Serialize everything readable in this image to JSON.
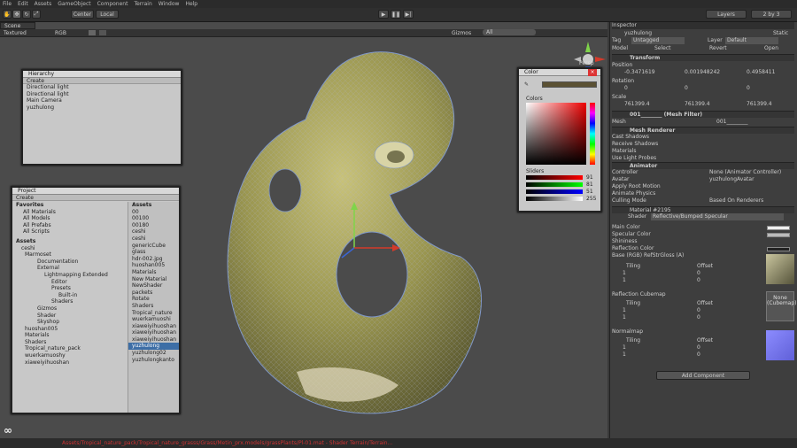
{
  "menu": [
    "File",
    "Edit",
    "Assets",
    "GameObject",
    "Component",
    "Terrain",
    "Window",
    "Help"
  ],
  "toolbar": {
    "pivot": "Center",
    "space": "Local",
    "layers": "Layers",
    "layout": "2 by 3"
  },
  "scene": {
    "tab": "Scene",
    "shading": "Textured",
    "mode": "RGB",
    "gizmos": "Gizmos",
    "search": "All",
    "persp": "Persp"
  },
  "hierarchy": {
    "title": "Hierarchy",
    "create": "Create",
    "items": [
      "Directional light",
      "Directional light",
      "Main Camera",
      "yuzhulong"
    ]
  },
  "project": {
    "title": "Project",
    "create": "Create",
    "favorites_header": "Favorites",
    "favorites": [
      "All Materials",
      "All Models",
      "All Prefabs",
      "All Scripts"
    ],
    "assets_header": "Assets",
    "tree": [
      "ceshi",
      "Marmoset",
      "Documentation",
      "External",
      "Lightmapping Extended",
      "Editor",
      "Presets",
      "Built-in",
      "Shaders",
      "Gizmos",
      "Shader",
      "Skyshop",
      "huoshan005",
      "Materials",
      "Shaders",
      "Tropical_nature_pack",
      "wuerkamuoshy",
      "xiaweiyihuoshan"
    ],
    "assets_col_header": "Assets",
    "assets": [
      "00",
      "00100",
      "00180",
      "ceshi",
      "ceshi",
      "genericCube",
      "glass",
      "hdr-002.jpg",
      "huoshan005",
      "Materials",
      "New Material",
      "NewShader",
      "packets",
      "Rotate",
      "Shaders",
      "Tropical_nature",
      "wuerkamuoshi",
      "xiaweiyihuoshan",
      "xiaweiyihuoshan",
      "xiaweiyihuoshan",
      "yuzhulong",
      "yuzhulong02",
      "yuzhulongkanto"
    ]
  },
  "color": {
    "title": "Color",
    "colors": "Colors",
    "sliders": "Sliders",
    "r": "91",
    "g": "81",
    "b": "51",
    "a": "255"
  },
  "inspector": {
    "title": "Inspector",
    "object": "yuzhulong",
    "static": "Static",
    "tag_label": "Tag",
    "tag": "Untagged",
    "layer_label": "Layer",
    "layer": "Default",
    "model": "Model",
    "select": "Select",
    "revert": "Revert",
    "open": "Open",
    "transform": "Transform",
    "position": "Position",
    "px": "-0.3471619",
    "py": "0.001948242",
    "pz": "0.4958411",
    "rotation": "Rotation",
    "rx": "0",
    "ry": "0",
    "rz": "0",
    "scale": "Scale",
    "sx": "761399.4",
    "sy": "761399.4",
    "sz": "761399.4",
    "meshfilter": "001________ (Mesh Filter)",
    "mesh_label": "Mesh",
    "mesh": "001________",
    "meshrenderer": "Mesh Renderer",
    "cast": "Cast Shadows",
    "receive": "Receive Shadows",
    "materials": "Materials",
    "lightprobes": "Use Light Probes",
    "animator": "Animator",
    "controller": "Controller",
    "controller_val": "None (Animator Controller)",
    "avatar": "Avatar",
    "avatar_val": "yuzhulongAvatar",
    "rootmotion": "Apply Root Motion",
    "physics": "Animate Physics",
    "culling": "Culling Mode",
    "culling_val": "Based On Renderers",
    "material": "Material #2195",
    "shader_label": "Shader",
    "shader": "Reflective/Bumped Specular",
    "maincolor": "Main Color",
    "speccolor": "Specular Color",
    "shininess": "Shininess",
    "reflcolor": "Reflection Color",
    "base": "Base (RGB) RefStrGloss (A)",
    "tiling": "Tiling",
    "offset": "Offset",
    "one": "1",
    "zero": "0",
    "cubemap": "Reflection Cubemap",
    "cubemap_val": "None (Cubemap)",
    "normalmap": "Normalmap",
    "selectbtn": "Select",
    "addcomp": "Add Component"
  },
  "status": "Assets/Tropical_nature_pack/Tropical_nature_grasss/Grass/Metin_prx.models/grassPlants/Pl-01.mat - Shader Terrain/Terrain..."
}
